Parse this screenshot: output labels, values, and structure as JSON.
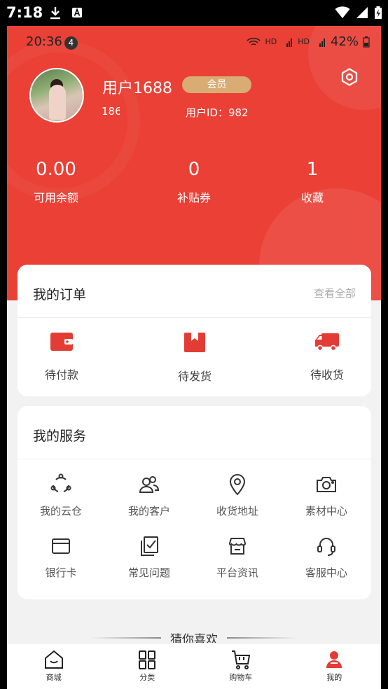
{
  "system_bar": {
    "time": "7:18"
  },
  "inner_status": {
    "time": "20:36",
    "badge": "4",
    "battery": "42%"
  },
  "profile": {
    "username": "用户1688",
    "member_badge": "会员",
    "phone": "186",
    "user_id": "用户ID：982"
  },
  "stats": [
    {
      "value": "0.00",
      "label": "可用余额"
    },
    {
      "value": "0",
      "label": "补贴券"
    },
    {
      "value": "1",
      "label": "收藏"
    }
  ],
  "orders": {
    "title": "我的订单",
    "view_all": "查看全部",
    "items": [
      {
        "label": "待付款",
        "icon": "wallet-icon"
      },
      {
        "label": "待发货",
        "icon": "package-icon"
      },
      {
        "label": "待收货",
        "icon": "truck-icon"
      }
    ]
  },
  "services": {
    "title": "我的服务",
    "items": [
      {
        "label": "我的云仓",
        "icon": "cloud-warehouse-icon"
      },
      {
        "label": "我的客户",
        "icon": "customers-icon"
      },
      {
        "label": "收货地址",
        "icon": "location-icon"
      },
      {
        "label": "素材中心",
        "icon": "camera-icon"
      },
      {
        "label": "银行卡",
        "icon": "bank-card-icon"
      },
      {
        "label": "常见问题",
        "icon": "faq-icon"
      },
      {
        "label": "平台资讯",
        "icon": "store-icon"
      },
      {
        "label": "客服中心",
        "icon": "headset-icon"
      }
    ]
  },
  "guess": {
    "title": "猜你喜欢"
  },
  "tabbar": {
    "items": [
      {
        "label": "商城",
        "icon": "home-icon"
      },
      {
        "label": "分类",
        "icon": "category-icon"
      },
      {
        "label": "购物车",
        "icon": "cart-icon"
      },
      {
        "label": "我的",
        "icon": "profile-icon"
      }
    ],
    "active": "我的"
  },
  "colors": {
    "primary": "#ea4036",
    "badge": "#d8ac73",
    "background": "#f2f2f2"
  }
}
